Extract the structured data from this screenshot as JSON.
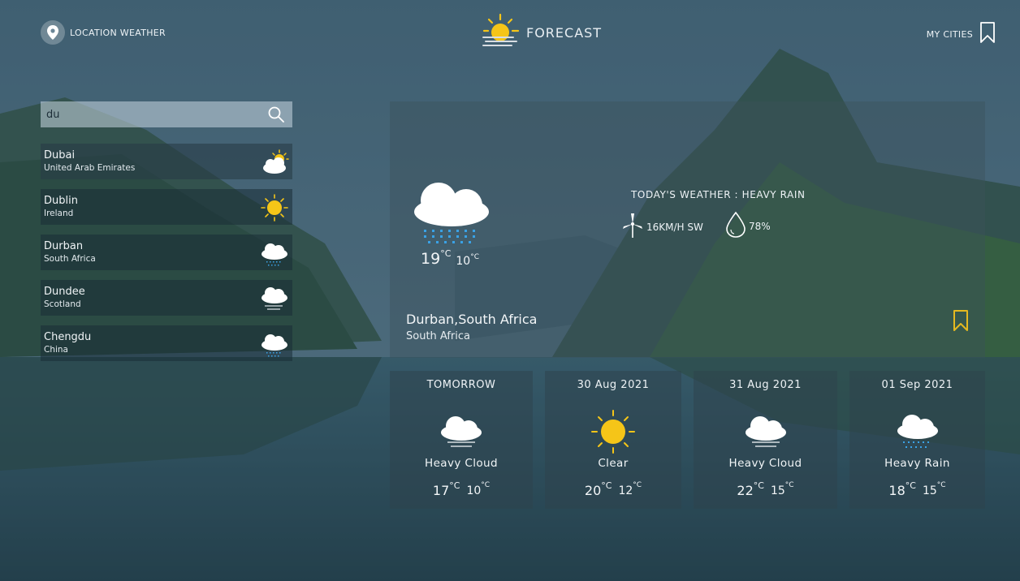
{
  "header": {
    "location_label": "LOCATION WEATHER",
    "brand": "FORECAST",
    "my_cities_label": "MY CITIES"
  },
  "search": {
    "value": "du",
    "placeholder": ""
  },
  "results": [
    {
      "city": "Dubai",
      "country": "United Arab Emirates",
      "icon": "partly-sunny-icon"
    },
    {
      "city": "Dublin",
      "country": "Ireland",
      "icon": "sun-icon"
    },
    {
      "city": "Durban",
      "country": "South Africa",
      "icon": "rain-cloud-icon"
    },
    {
      "city": "Dundee",
      "country": "Scotland",
      "icon": "cloud-fog-icon"
    },
    {
      "city": "Chengdu",
      "country": "China",
      "icon": "rain-cloud-icon"
    }
  ],
  "today": {
    "label": "TODAY'S WEATHER : HEAVY RAIN",
    "wind": "16KM/H SW",
    "humidity": "78%",
    "temp_high": "19",
    "temp_low": "10",
    "unit": "°C",
    "location": "Durban,South Africa",
    "country": "South Africa",
    "icon": "heavy-rain-icon"
  },
  "forecast": [
    {
      "day": "TOMORROW",
      "condition": "Heavy Cloud",
      "high": "17",
      "low": "10",
      "icon": "heavy-cloud-icon"
    },
    {
      "day": "30 Aug 2021",
      "condition": "Clear",
      "high": "20",
      "low": "12",
      "icon": "sun-icon"
    },
    {
      "day": "31 Aug 2021",
      "condition": "Heavy Cloud",
      "high": "22",
      "low": "15",
      "icon": "heavy-cloud-icon"
    },
    {
      "day": "01 Sep 2021",
      "condition": "Heavy Rain",
      "high": "18",
      "low": "15",
      "icon": "heavy-rain-icon"
    }
  ],
  "colors": {
    "accent_sun": "#f5c518",
    "bookmark_active": "#e5b920",
    "rain_drop": "#3aa2e6"
  }
}
